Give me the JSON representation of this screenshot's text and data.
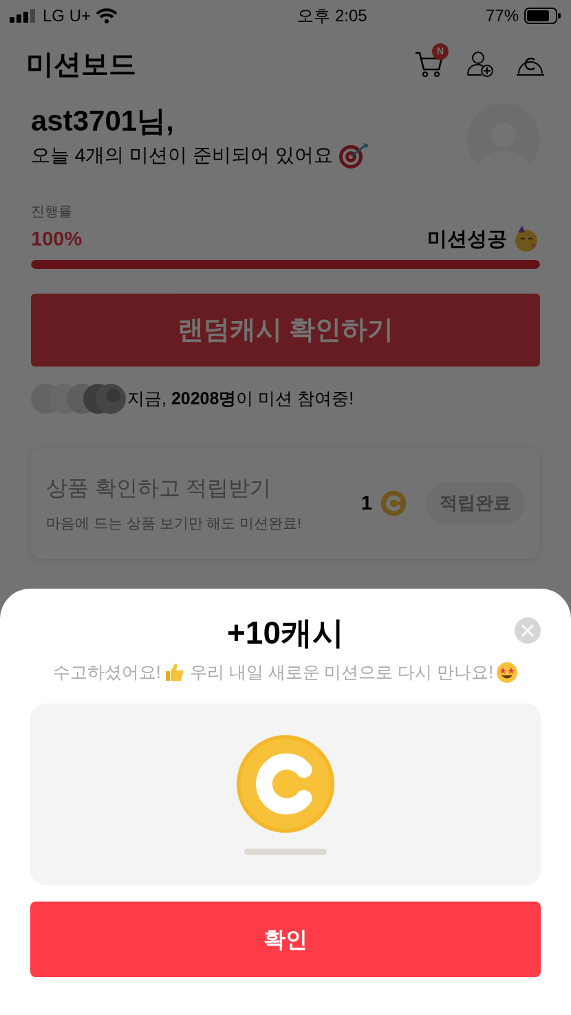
{
  "status_bar": {
    "carrier": "LG U+",
    "time": "오후 2:05",
    "battery": "77%"
  },
  "header": {
    "title": "미션보드",
    "cart_badge": "N"
  },
  "greeting": {
    "name": "ast3701님,",
    "message": "오늘 4개의 미션이 준비되어 있어요"
  },
  "progress": {
    "label": "진행률",
    "percent": "100%",
    "status": "미션성공",
    "level": 1
  },
  "random_cash_button": "랜덤캐시 확인하기",
  "participants": "지금, **20208명**이 미션 참여중!",
  "missions": [
    {
      "title": "상품 확인하고 적립받기",
      "subtitle": "마음에 드는 상품 보기만 해도 미션완료!",
      "reward": "1",
      "button": "적립완료",
      "completed": true
    }
  ],
  "sheet": {
    "title": "+10캐시",
    "message_1": "수고하셨어요!",
    "message_2": "우리 내일 새로운 미션으로 다시 만나요!",
    "confirm": "확인"
  }
}
